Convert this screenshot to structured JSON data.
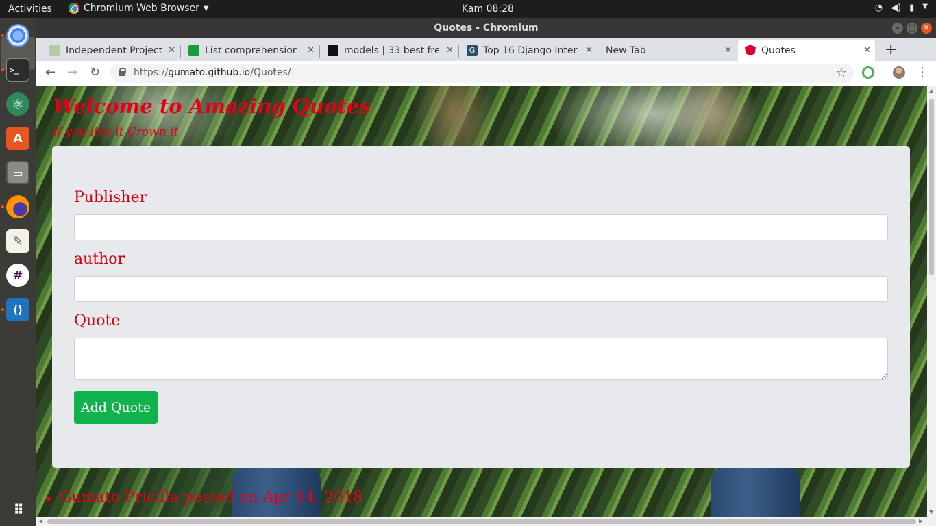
{
  "topbar": {
    "activities": "Activities",
    "app_name": "Chromium Web Browser",
    "clock": "Kam 08:28"
  },
  "dock": {
    "items": [
      "chromium-icon",
      "terminal-icon",
      "atom-icon",
      "software-center-icon",
      "files-icon",
      "firefox-icon",
      "text-editor-icon",
      "slack-icon",
      "vscode-icon",
      "app-grid-icon"
    ]
  },
  "window": {
    "title": "Quotes - Chromium"
  },
  "tabs": [
    {
      "label": "Independent Project",
      "favicon_color": "#6b8e5a"
    },
    {
      "label": "List comprehension",
      "favicon_color": "#1a9e3a"
    },
    {
      "label": "models | 33 best free",
      "favicon_color": "#111111"
    },
    {
      "label": "Top 16 Django Interv",
      "favicon_color": "#2b4f66"
    },
    {
      "label": "New Tab",
      "favicon_color": ""
    },
    {
      "label": "Quotes",
      "favicon_color": "#dd0031"
    }
  ],
  "omnibox": {
    "scheme": "https://",
    "host": "gumato.github.io",
    "path": "/Quotes/"
  },
  "page": {
    "title": "Welcome to Amazing Quotes",
    "tagline": "If you like it Crown it",
    "form": {
      "publisher_label": "Publisher",
      "publisher_value": "",
      "author_label": "author",
      "author_value": "",
      "quote_label": "Quote",
      "quote_value": "",
      "submit_label": "Add Quote"
    },
    "quotes": [
      {
        "text": "Gumato Pricilla posted on Apr 14, 2018"
      }
    ]
  },
  "colors": {
    "accent_red": "#e5001a",
    "button_green": "#10b24c",
    "ubuntu_orange": "#e95420"
  }
}
